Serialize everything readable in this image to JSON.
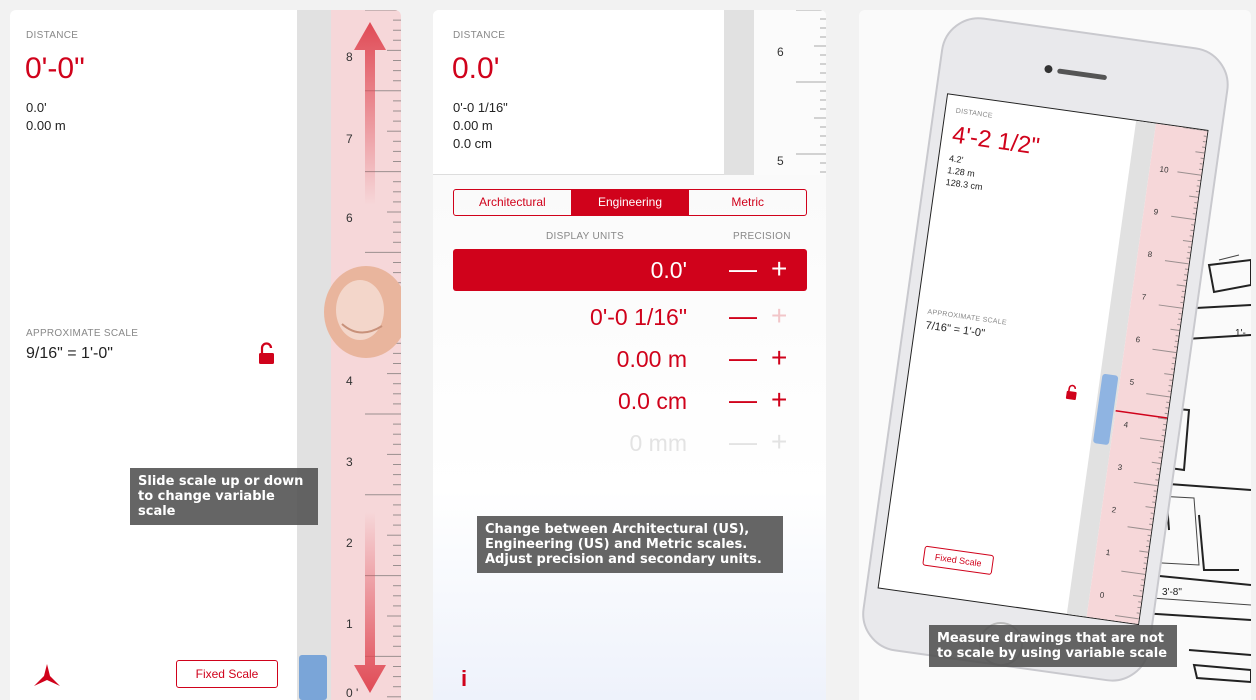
{
  "panel1": {
    "distance_label": "DISTANCE",
    "distance_value": "0'-0\"",
    "sec1": "0.0'",
    "sec2": "0.00 m",
    "scale_label": "APPROXIMATE SCALE",
    "scale_value": "9/16\" = 1'-0\"",
    "fixed_scale": "Fixed Scale",
    "tip": "Slide scale up or down to change variable scale",
    "ruler_numbers": [
      "8",
      "7",
      "6",
      "4",
      "3",
      "2",
      "1",
      "0 '"
    ]
  },
  "panel2": {
    "distance_label": "DISTANCE",
    "distance_value": "0.0'",
    "sec1": "0'-0 1/16\"",
    "sec2": "0.00 m",
    "sec3": "0.0 cm",
    "ruler_numbers": [
      "6",
      "5"
    ],
    "tabs": [
      "Architectural",
      "Engineering",
      "Metric"
    ],
    "active_tab": "Engineering",
    "display_units_label": "DISPLAY UNITS",
    "precision_label": "PRECISION",
    "units": [
      "0.0'",
      "0'-0 1/16\"",
      "0.00 m",
      "0.0 cm",
      "0 mm"
    ],
    "minus": "—",
    "plus": "+",
    "tip": "Change between Architectural (US), Engineering (US) and Metric scales. Adjust precision and secondary units.",
    "info": "i"
  },
  "panel3": {
    "distance_label": "DISTANCE",
    "distance_value": "4'-2 1/2\"",
    "sec1": "4.2'",
    "sec2": "1.28 m",
    "sec3": "128.3 cm",
    "scale_label": "APPROXIMATE SCALE",
    "scale_value": "7/16\" = 1'-0\"",
    "fixed_scale": "Fixed Scale",
    "ruler_numbers": [
      "10",
      "9",
      "8",
      "7",
      "6",
      "5",
      "4",
      "3",
      "2",
      "1",
      "0"
    ],
    "drawing_labels": [
      "3'-8\"",
      "1'-"
    ],
    "tip": "Measure drawings that are not to scale by using variable scale"
  },
  "colors": {
    "accent": "#d0021b",
    "ruler_pink": "#f6d7d9",
    "ruler_gray": "#e1e1e1"
  }
}
